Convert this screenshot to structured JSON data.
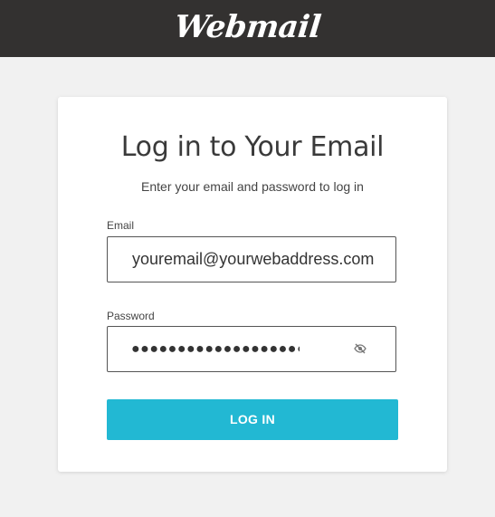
{
  "header": {
    "logo_text": "Webmail"
  },
  "card": {
    "title": "Log in to Your Email",
    "subtitle": "Enter your email and password to log in"
  },
  "form": {
    "email_label": "Email",
    "email_value": "youremail@yourwebaddress.com",
    "password_label": "Password",
    "password_masked": "●●●●●●●●●●●●●●●●●●●",
    "password_toggle_icon": "eye-slash-icon",
    "submit_label": "LOG IN"
  },
  "colors": {
    "header_bg": "#333130",
    "page_bg": "#f1f1f1",
    "button_bg": "#22b8d3",
    "button_text": "#ffffff"
  }
}
